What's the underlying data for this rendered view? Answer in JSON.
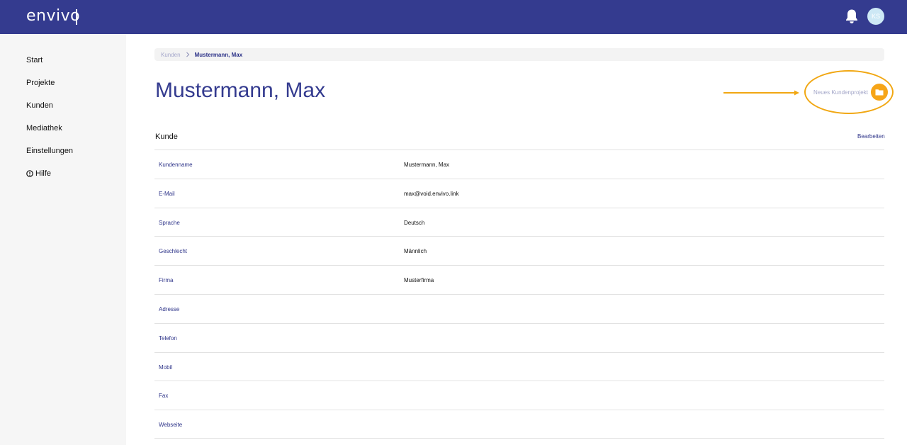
{
  "header": {
    "logo": "envivo",
    "avatar_initials": "KS",
    "brand_color": "#343b8f"
  },
  "sidebar": {
    "items": [
      {
        "label": "Start"
      },
      {
        "label": "Projekte"
      },
      {
        "label": "Kunden"
      },
      {
        "label": "Mediathek"
      },
      {
        "label": "Einstellungen"
      },
      {
        "label": "Hilfe"
      }
    ]
  },
  "breadcrumb": {
    "parent": "Kunden",
    "current": "Mustermann, Max"
  },
  "page": {
    "title": "Mustermann, Max",
    "new_project_label": "Neues Kundenprojekt",
    "accent_color": "#f6a518"
  },
  "section": {
    "title": "Kunde",
    "edit_label": "Bearbeiten"
  },
  "fields": [
    {
      "label": "Kundenname",
      "value": "Mustermann, Max"
    },
    {
      "label": "E-Mail",
      "value": "max@void.envivo.link"
    },
    {
      "label": "Sprache",
      "value": "Deutsch"
    },
    {
      "label": "Geschlecht",
      "value": "Männlich"
    },
    {
      "label": "Firma",
      "value": "Musterfirma"
    },
    {
      "label": "Adresse",
      "value": ""
    },
    {
      "label": "Telefon",
      "value": ""
    },
    {
      "label": "Mobil",
      "value": ""
    },
    {
      "label": "Fax",
      "value": ""
    },
    {
      "label": "Webseite",
      "value": ""
    }
  ]
}
